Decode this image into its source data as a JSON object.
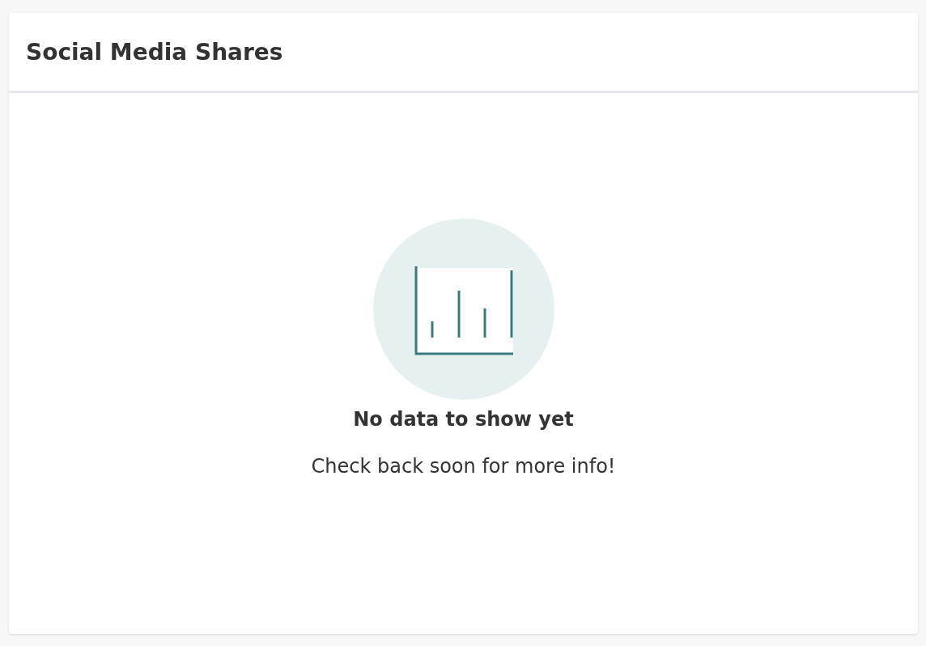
{
  "card": {
    "title": "Social Media Shares"
  },
  "empty_state": {
    "heading": "No data to show yet",
    "message": "Check back soon for more info!"
  }
}
